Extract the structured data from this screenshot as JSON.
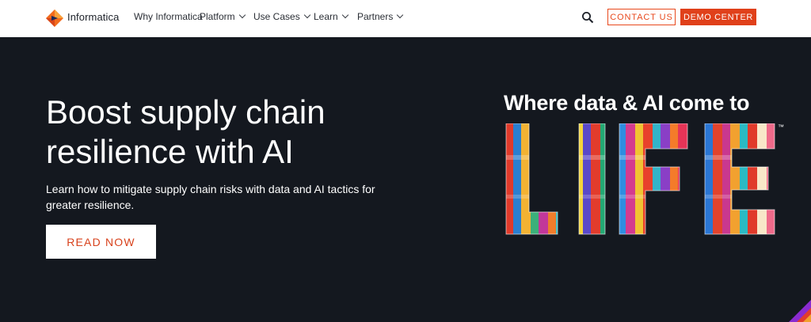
{
  "nav": {
    "logo_text": "Informatica",
    "items": [
      {
        "label": "Why Informatica",
        "has_dropdown": false
      },
      {
        "label": "Platform",
        "has_dropdown": true
      },
      {
        "label": "Use Cases",
        "has_dropdown": true
      },
      {
        "label": "Learn",
        "has_dropdown": true
      },
      {
        "label": "Partners",
        "has_dropdown": true
      }
    ],
    "search_icon": "search-icon",
    "contact_label": "CONTACT US",
    "demo_label": "DEMO CENTER"
  },
  "hero": {
    "title_line1": "Boost supply chain",
    "title_line2": "resilience with AI",
    "subtitle": "Learn how to mitigate supply chain risks with data and AI tactics for greater resilience.",
    "cta_label": "READ NOW"
  },
  "promo": {
    "tagline": "Where data & AI come to",
    "art_text": "LIFE",
    "trademark": "™"
  },
  "colors": {
    "accent": "#e0401a",
    "background": "#14181f",
    "nav_bg": "#ffffff"
  }
}
